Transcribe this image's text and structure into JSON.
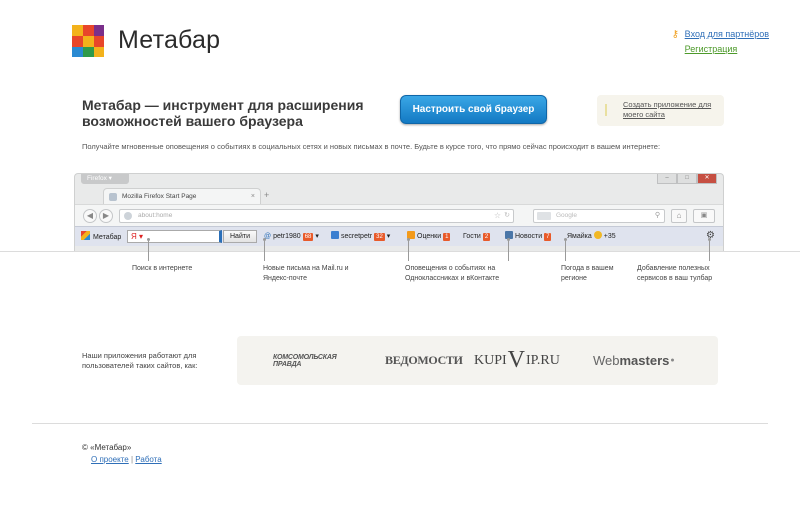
{
  "header": {
    "logo_text": "Метабар",
    "partner_login": "Вход для партнёров",
    "registration": "Регистрация"
  },
  "hero": {
    "headline": "Метабар — инструмент для расширения возможностей вашего браузера",
    "cta_label": "Настроить свой браузер",
    "create_app": "Создать приложение для моего сайта",
    "lead": "Получайте мгновенные оповещения о событиях в социальных сетях и новых письмах в почте. Будьте в курсе того, что прямо сейчас происходит в вашем интернете:"
  },
  "browser": {
    "firefox_label": "Firefox ▾",
    "tab_title": "Mozilla Firefox Start Page",
    "url": "about:home",
    "search_placeholder": "Google",
    "metabar": {
      "label": "Метабар",
      "search_value": "Я ▾",
      "find_label": "Найти",
      "mail1": "petr1980",
      "mail1_count": "68",
      "mail2": "secretpetr",
      "mail2_count": "32",
      "ok_ratings": "Оценки",
      "ok_ratings_count": "1",
      "ok_guests": "Гости",
      "ok_guests_count": "2",
      "vk_news": "Новости",
      "vk_news_count": "7",
      "weather_city": "Ямайка",
      "weather_temp": "+35"
    }
  },
  "callouts": [
    {
      "text": "Поиск в интернете"
    },
    {
      "text": "Новые письма на Mail.ru и Яндекс-почте"
    },
    {
      "text": "Оповещения о событиях на Одноклассниках и вКонтакте"
    },
    {
      "text": "Погода в вашем регионе"
    },
    {
      "text": "Добавление полезных сервисов в ваш тулбар"
    }
  ],
  "partners": {
    "text": "Наши приложения работают для пользователей таких сайтов, как:",
    "logos": {
      "kp_line1": "КОМСОМОЛЬСКАЯ",
      "kp_line2": "ПРАВДА",
      "vedomosti": "ВЕДОМОСТИ",
      "kupi_a": "KUPI",
      "kupi_v": "V",
      "kupi_b": "IP.RU",
      "wm_a": "Web",
      "wm_b": "masters"
    }
  },
  "footer": {
    "copyright": "© «Метабар»",
    "about": "О проекте",
    "separator": "|",
    "jobs": "Работа"
  }
}
